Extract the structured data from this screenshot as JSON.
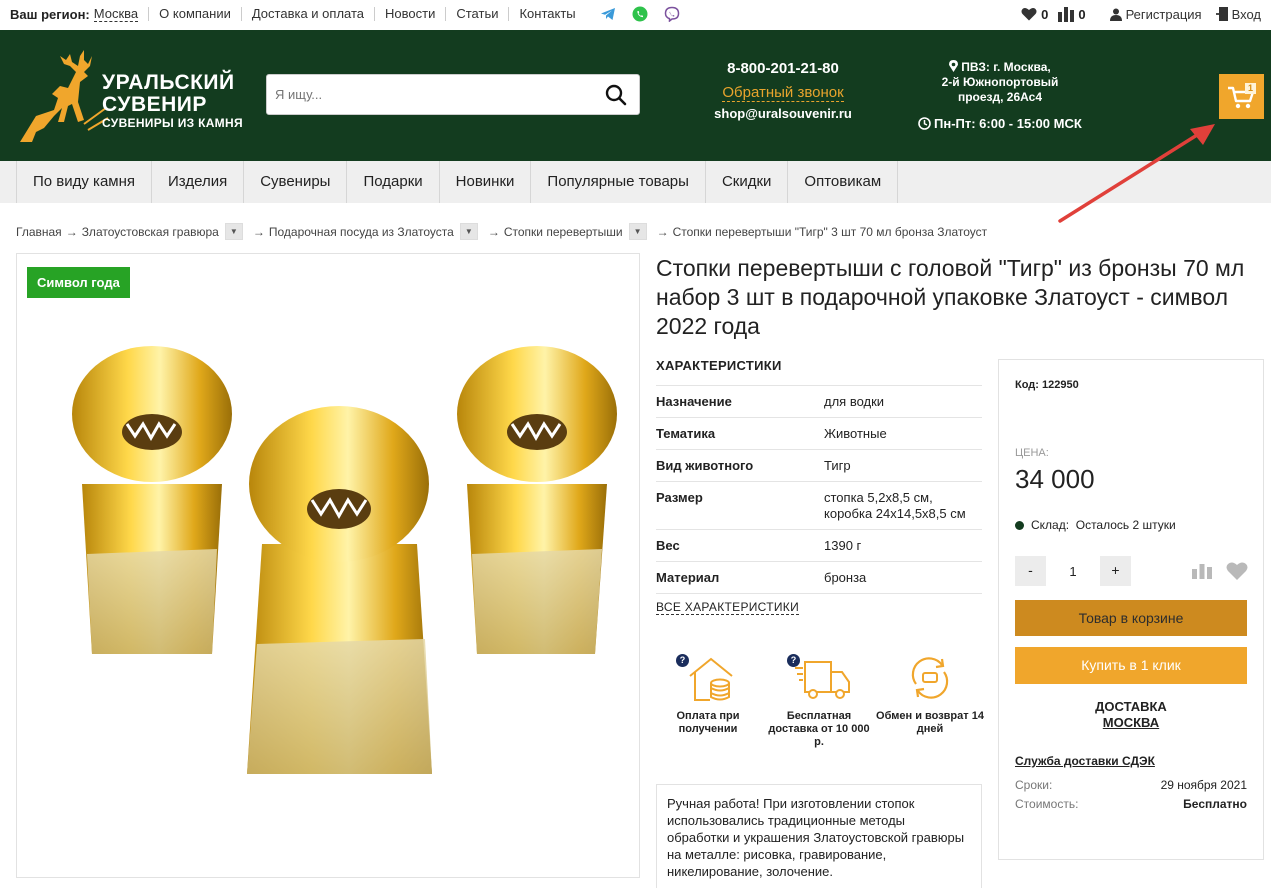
{
  "topbar": {
    "region_label": "Ваш регион:",
    "region_value": "Москва",
    "links": [
      "О компании",
      "Доставка и оплата",
      "Новости",
      "Статьи",
      "Контакты"
    ],
    "favorites_count": "0",
    "compare_count": "0",
    "register": "Регистрация",
    "login": "Вход"
  },
  "header": {
    "logo_line1": "УРАЛЬСКИЙ",
    "logo_line2": "СУВЕНИР",
    "logo_line3": "СУВЕНИРЫ ИЗ КАМНЯ",
    "search_placeholder": "Я ищу...",
    "phone": "8-800-201-21-80",
    "callback": "Обратный звонок",
    "email": "shop@uralsouvenir.ru",
    "pvz_line1": "ПВЗ: г. Москва,",
    "pvz_line2": "2-й Южнопортовый",
    "pvz_line3": "проезд, 26Ас4",
    "hours": "Пн-Пт: 6:00 - 15:00 МСК",
    "cart_count": "1",
    "accent_color": "#f0a62c",
    "header_bg": "#133c1f"
  },
  "nav": {
    "items": [
      "По виду камня",
      "Изделия",
      "Сувениры",
      "Подарки",
      "Новинки",
      "Популярные товары",
      "Скидки",
      "Оптовикам"
    ]
  },
  "breadcrumb": {
    "home": "Главная",
    "c1": "Златоустовская гравюра",
    "c2": "Подарочная посуда из Златоуста",
    "c3": "Стопки перевертыши",
    "current": "Стопки перевертыши \"Тигр\" 3 шт 70 мл бронза Златоуст",
    "arrow": "→"
  },
  "product": {
    "badge": "Символ года",
    "title": "Стопки перевертыши с головой \"Тигр\" из бронзы 70 мл набор 3 шт в подарочной упаковке Златоуст - символ 2022 года",
    "char_heading": "ХАРАКТЕРИСТИКИ",
    "characteristics": [
      {
        "k": "Назначение",
        "v": "для водки"
      },
      {
        "k": "Тематика",
        "v": "Животные"
      },
      {
        "k": "Вид животного",
        "v": "Тигр"
      },
      {
        "k": "Размер",
        "v": "стопка 5,2х8,5 см, коробка 24х14,5х8,5 см"
      },
      {
        "k": "Вес",
        "v": "1390 г"
      },
      {
        "k": "Материал",
        "v": "бронза"
      }
    ],
    "all_chars": "ВСЕ ХАРАКТЕРИСТИКИ",
    "features": [
      {
        "label": "Оплата при получении"
      },
      {
        "label": "Бесплатная доставка от 10 000 р."
      },
      {
        "label": "Обмен и возврат 14 дней"
      }
    ],
    "description": "Ручная работа! При изготовлении стопок использовались традиционные методы обработки и украшения Златоустовской гравюры на металле: рисовка, гравирование, никелирование, золочение."
  },
  "buy": {
    "code": "Код: 122950",
    "price_label": "ЦЕНА:",
    "price": "34 000",
    "stock_label": "Склад:",
    "stock_value": "Осталось 2 штуки",
    "qty_minus": "-",
    "qty": "1",
    "qty_plus": "+",
    "in_cart": "Товар в корзине",
    "one_click": "Купить в 1 клик",
    "delivery_title": "ДОСТАВКА",
    "delivery_city": "МОСКВА",
    "service": "Служба доставки СДЭК",
    "term_label": "Сроки:",
    "term_value": "29 ноября 2021",
    "cost_label": "Стоимость:",
    "cost_value": "Бесплатно"
  }
}
